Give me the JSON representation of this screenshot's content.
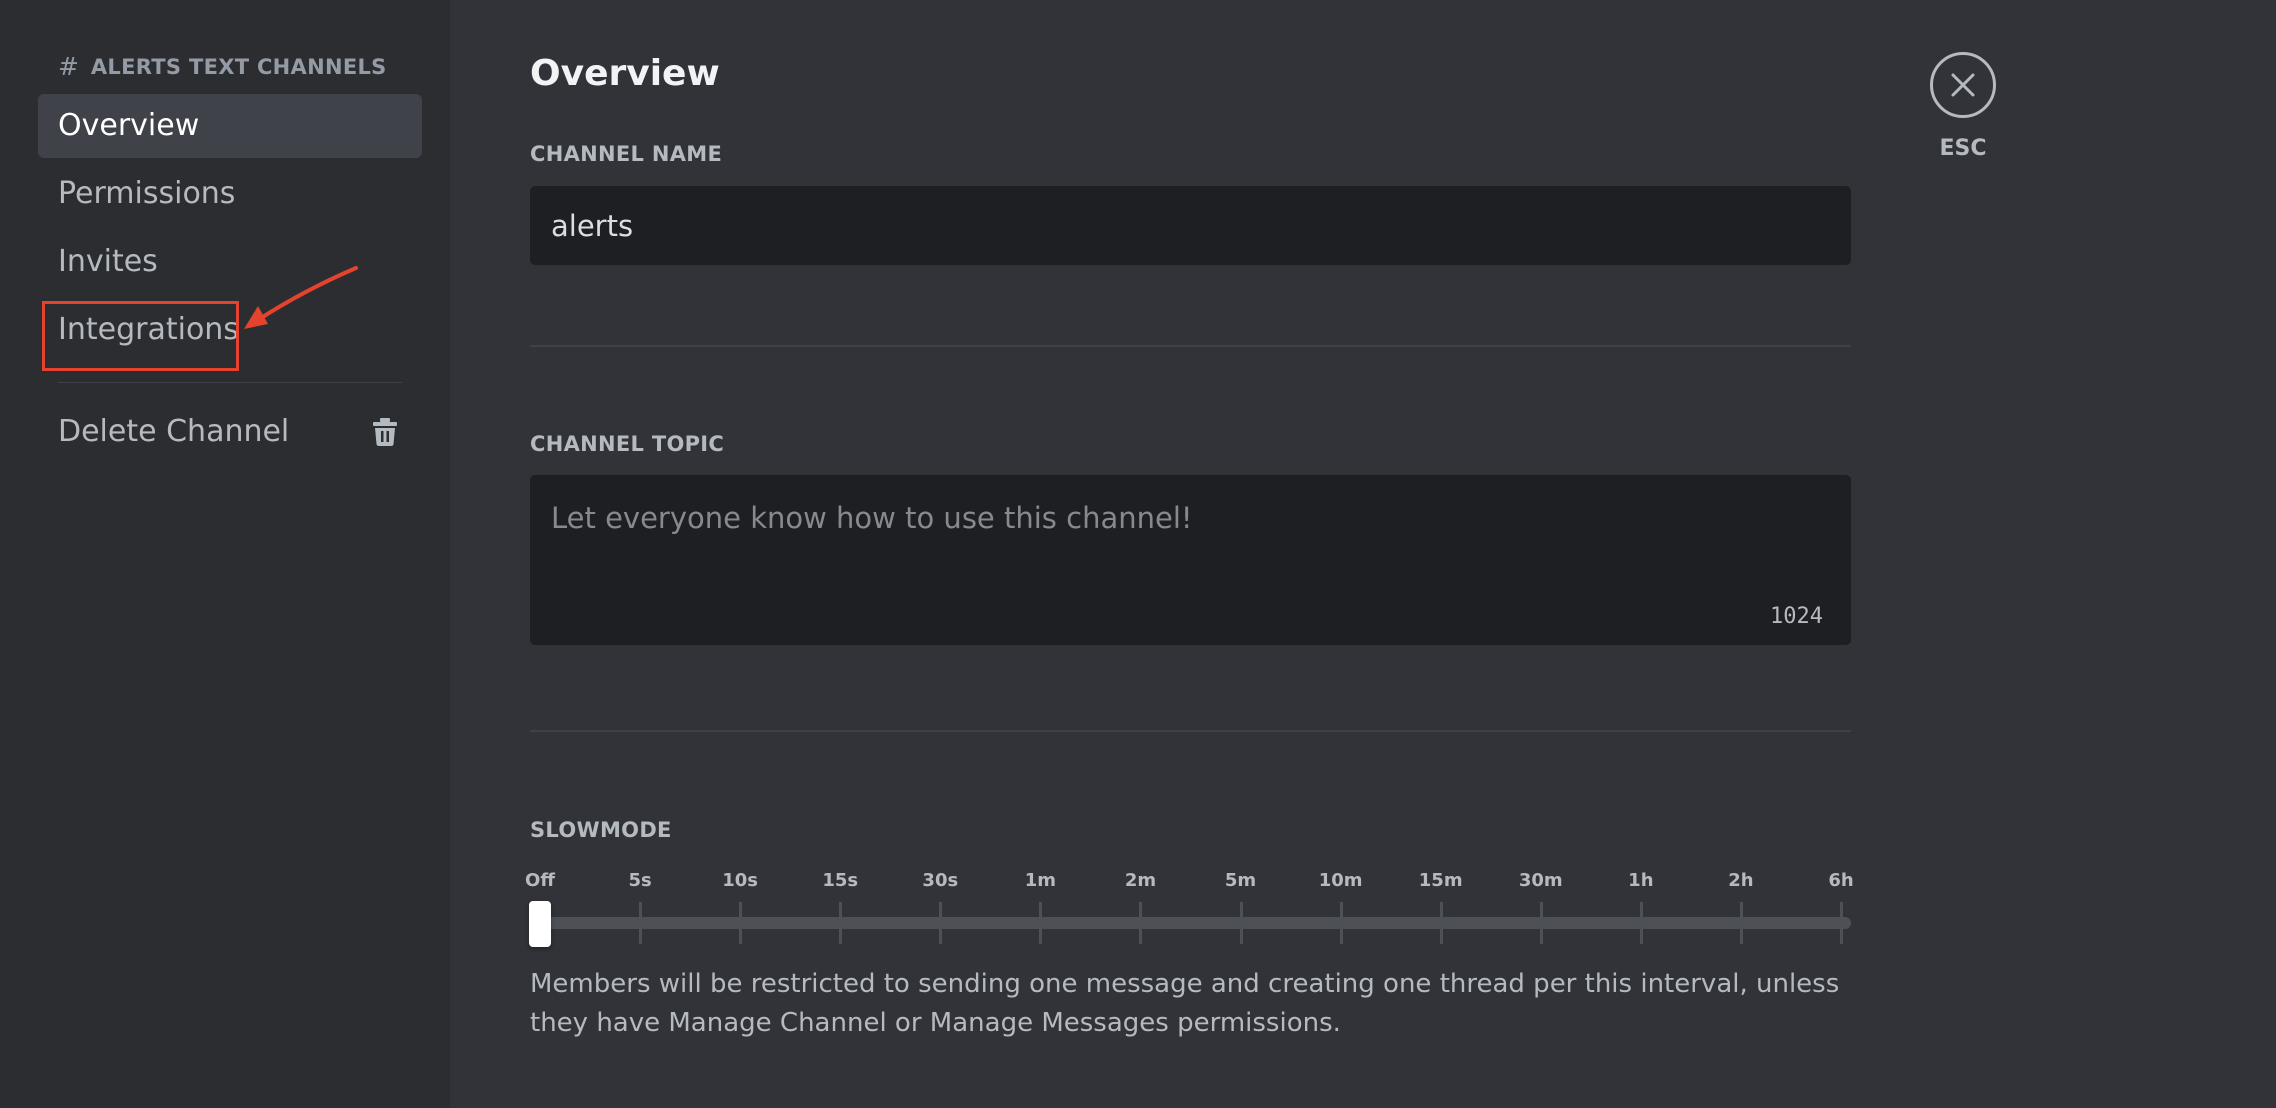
{
  "sidebar": {
    "header_channel": "ALERTS",
    "header_suffix": "TEXT CHANNELS",
    "items": [
      {
        "label": "Overview"
      },
      {
        "label": "Permissions"
      },
      {
        "label": "Invites"
      },
      {
        "label": "Integrations"
      }
    ],
    "delete_label": "Delete Channel",
    "delete_icon": "trash-icon"
  },
  "main": {
    "title": "Overview",
    "channel_name": {
      "label": "CHANNEL NAME",
      "value": "alerts"
    },
    "channel_topic": {
      "label": "CHANNEL TOPIC",
      "placeholder": "Let everyone know how to use this channel!",
      "char_count": "1024"
    },
    "slowmode": {
      "label": "SLOWMODE",
      "ticks": [
        "Off",
        "5s",
        "10s",
        "15s",
        "30s",
        "1m",
        "2m",
        "5m",
        "10m",
        "15m",
        "30m",
        "1h",
        "2h",
        "6h"
      ],
      "selected_index": 0,
      "help": "Members will be restricted to sending one message and creating one thread per this interval, unless they have Manage Channel or Manage Messages permissions."
    }
  },
  "close": {
    "label": "ESC",
    "icon": "close-icon"
  },
  "colors": {
    "annotation": "#e5432d",
    "background": "#313338",
    "sidebar": "#2b2d31"
  }
}
